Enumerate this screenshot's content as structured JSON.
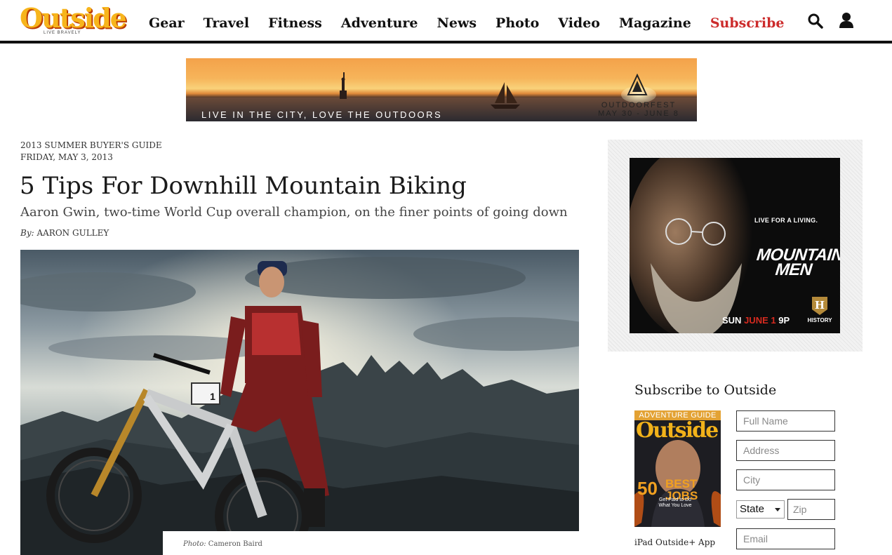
{
  "header": {
    "logo": {
      "name": "Outside",
      "tagline": "LIVE BRAVELY"
    },
    "nav": [
      "Gear",
      "Travel",
      "Fitness",
      "Adventure",
      "News",
      "Photo",
      "Video",
      "Magazine",
      "Subscribe"
    ],
    "icons": {
      "search": "search-icon",
      "account": "user-icon"
    },
    "colors": {
      "subscribe_link": "#cc2b2b",
      "logo": "#f7b51c"
    }
  },
  "top_banner": {
    "text": "LIVE IN THE CITY, LOVE THE OUTDOORS",
    "brand": "OUTDOORFEST",
    "dates": "MAY 30 - JUNE 8"
  },
  "article": {
    "kicker": "2013 SUMMER BUYER'S GUIDE",
    "date": "FRIDAY, MAY 3, 2013",
    "headline": "5 Tips For Downhill Mountain Biking",
    "dek": "Aaron Gwin, two-time World Cup overall champion, on the finer points of going down",
    "byline_label": "By:",
    "author": "AARON GULLEY",
    "photo": {
      "plate_number": "1",
      "caption_label": "Photo:",
      "credit": "Cameron Baird"
    }
  },
  "sidebar_ad": {
    "tagline": "LIVE FOR A LIVING.",
    "title": "MOUNTAIN MEN",
    "date_prefix": "SUN",
    "date_highlight": "JUNE 1",
    "time": "9P",
    "network_logo": "H",
    "network": "HISTORY",
    "colors": {
      "highlight": "#d62a1f"
    }
  },
  "subscribe": {
    "title": "Subscribe to Outside",
    "cover": {
      "header": "ADVENTURE GUIDE",
      "masthead": "Outside",
      "big_number": "50",
      "big_word": "BEST JOBS",
      "sub": "Get Paid to Do What You Love"
    },
    "ipad_link": "iPad Outside+ App",
    "fields": {
      "full_name": "Full Name",
      "address": "Address",
      "city": "City",
      "state": "State",
      "zip": "Zip",
      "email": "Email"
    }
  }
}
